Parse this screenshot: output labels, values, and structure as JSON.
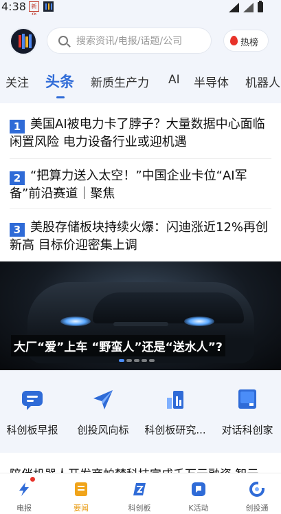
{
  "status_bar": {
    "time": "4:38",
    "app_badge_1": "新华",
    "icons": [
      "app-badge-icon",
      "app-badge-icon",
      "signal-icon",
      "battery-icon"
    ]
  },
  "header": {
    "search_placeholder": "搜索资讯/电报/话题/公司",
    "hot_label": "热榜"
  },
  "tabs": [
    {
      "label": "关注"
    },
    {
      "label": "头条",
      "active": true
    },
    {
      "label": "新质生产力"
    },
    {
      "label": "AI"
    },
    {
      "label": "半导体"
    },
    {
      "label": "机器人"
    }
  ],
  "headlines": [
    {
      "rank": "1",
      "title": "美国AI被电力卡了脖子？大量数据中心面临闲置风险 电力设备行业或迎机遇"
    },
    {
      "rank": "2",
      "title": "“把算力送入太空！”中国企业卡位“AI军备”前沿赛道｜聚焦"
    },
    {
      "rank": "3",
      "title": "美股存储板块持续火爆：闪迪涨近12%再创新高 目标价迎密集上调"
    }
  ],
  "banner": {
    "title": "大厂“爱”上车 “野蛮人”还是“送水人”?",
    "slides": 5,
    "active_slide": 1
  },
  "shortcuts": [
    {
      "label": "科创板早报",
      "icon": "chat-bubble-icon",
      "color": "#2f6bd7"
    },
    {
      "label": "创投风向标",
      "icon": "paper-plane-icon",
      "color": "#2f6bd7"
    },
    {
      "label": "科创板研究...",
      "icon": "bar-chart-icon",
      "color": "#2f6bd7"
    },
    {
      "label": "对话科创家",
      "icon": "notebook-icon",
      "color": "#2f6bd7"
    }
  ],
  "news_peek": "陪伴机器人开发商帕梵科技完成千万元融资 智元",
  "bottom_nav": [
    {
      "label": "电报",
      "icon": "lightning-icon",
      "badge": true
    },
    {
      "label": "要闻",
      "icon": "news-icon",
      "active": true
    },
    {
      "label": "科创板",
      "icon": "kechuang-icon"
    },
    {
      "label": "K活动",
      "icon": "k-activity-icon"
    },
    {
      "label": "创投通",
      "icon": "chuangtou-icon"
    }
  ],
  "colors": {
    "accent": "#2f6bd7",
    "active_nav": "#e89a11",
    "hot": "#e8332a"
  }
}
